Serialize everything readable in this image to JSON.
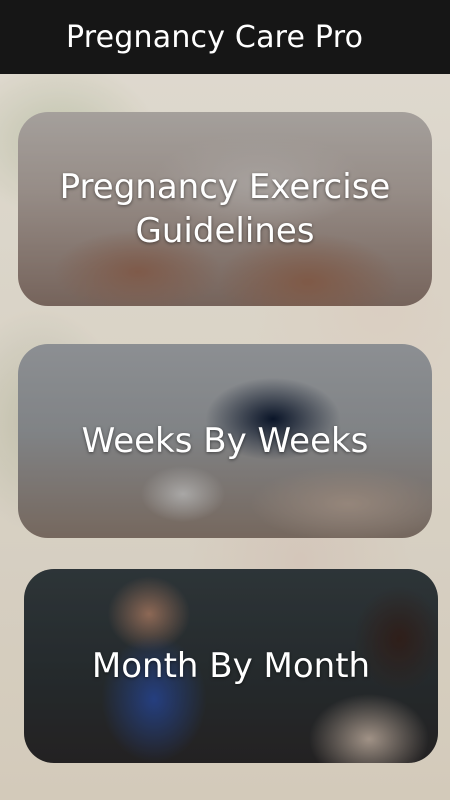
{
  "app": {
    "title": "Pregnancy Care Pro"
  },
  "menu": {
    "items": [
      {
        "label": "Pregnancy Exercise Guidelines"
      },
      {
        "label": "Weeks By Weeks"
      },
      {
        "label": "Month By Month"
      }
    ]
  },
  "colors": {
    "titlebar_bg": "#161616",
    "title_text": "#ffffff",
    "card_text": "#ffffff"
  }
}
